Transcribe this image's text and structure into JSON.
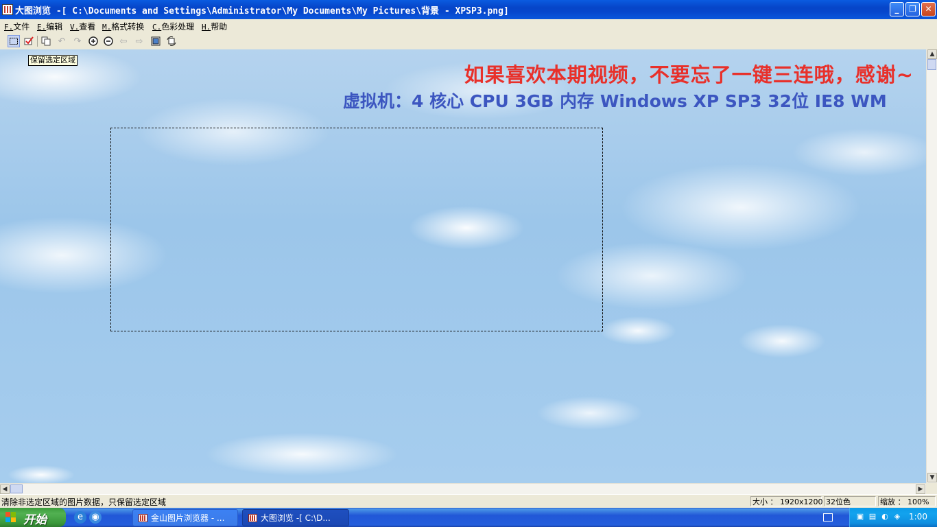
{
  "window": {
    "title": "大图浏览 -[ C:\\Documents and Settings\\Administrator\\My Documents\\My Pictures\\背景 - XPSP3.png]",
    "minimize": "_",
    "restore": "❐",
    "close": "✕"
  },
  "menu": {
    "items": [
      {
        "key": "F.",
        "label": "文件"
      },
      {
        "key": "E.",
        "label": "编辑"
      },
      {
        "key": "V.",
        "label": "查看"
      },
      {
        "key": "M.",
        "label": "格式转换"
      },
      {
        "key": "C.",
        "label": "色彩处理"
      },
      {
        "key": "H.",
        "label": "帮助"
      }
    ]
  },
  "toolbar": {
    "tooltip": "保留选定区域",
    "icons": [
      "select-rect-icon",
      "keep-selection-icon",
      "copy-icon",
      "undo-icon",
      "redo-icon",
      "zoom-in-icon",
      "zoom-out-icon",
      "back-arrow-icon",
      "forward-arrow-icon",
      "fit-window-icon",
      "rotate-icon"
    ]
  },
  "image": {
    "line1": "如果喜欢本期视频，不要忘了一键三连哦，感谢~",
    "line2": "虚拟机：4 核心 CPU   3GB 内存   Windows XP SP3 32位   IE8   WM",
    "line1_color": "#e8302a",
    "line2_color": "#3c56c0"
  },
  "status": {
    "message": "清除非选定区域的图片数据，只保留选定区域",
    "size_label": "大小 ：",
    "size_value": "1920x1200",
    "depth": "32位色",
    "zoom_label": "缩放 ：",
    "zoom_value": "100%"
  },
  "taskbar": {
    "start_label": "开始",
    "tasks": [
      {
        "label": "金山图片浏览器 - ...",
        "active": false
      },
      {
        "label": "大图浏览 -[ C:\\D...",
        "active": true
      }
    ],
    "clock": "1:00"
  }
}
